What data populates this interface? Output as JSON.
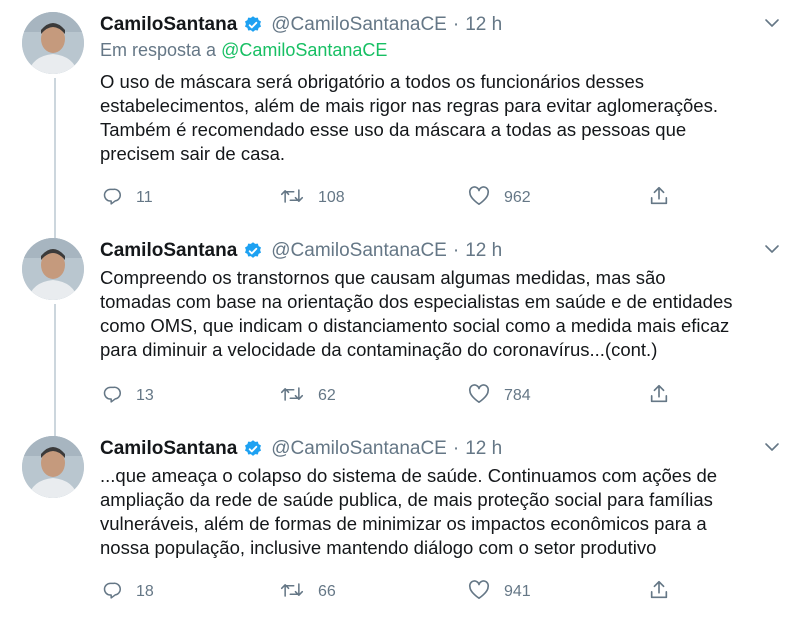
{
  "tweets": [
    {
      "name": "CamiloSantana",
      "handle": "@CamiloSantanaCE",
      "separator": "·",
      "time": "12 h",
      "reply_prefix": "Em resposta a ",
      "reply_mention": "@CamiloSantanaCE",
      "lines": [
        "O uso de máscara será obrigatório a todos os funcionários desses",
        "estabelecimentos, além de mais rigor nas regras para evitar aglomerações.",
        "Também é recomendado esse uso da máscara a todas as pessoas que",
        "precisem sair de casa."
      ],
      "replies": "11",
      "retweets": "108",
      "likes": "962"
    },
    {
      "name": "CamiloSantana",
      "handle": "@CamiloSantanaCE",
      "separator": "·",
      "time": "12 h",
      "lines": [
        "Compreendo os transtornos  que causam algumas medidas, mas são",
        "tomadas com base na orientação dos especialistas em saúde e de entidades",
        "como OMS, que indicam o distanciamento social como a medida mais eficaz",
        "para diminuir a velocidade da contaminação do coronavírus...(cont.)"
      ],
      "replies": "13",
      "retweets": "62",
      "likes": "784"
    },
    {
      "name": "CamiloSantana",
      "handle": "@CamiloSantanaCE",
      "separator": "·",
      "time": "12 h",
      "lines": [
        "...que ameaça o colapso do sistema de saúde. Continuamos com ações de",
        "ampliação da rede de saúde publica, de mais proteção social para famílias",
        "vulneráveis, além de formas de minimizar os impactos econômicos para a",
        "nossa população, inclusive mantendo diálogo com o setor produtivo"
      ],
      "replies": "18",
      "retweets": "66",
      "likes": "941"
    }
  ],
  "icons": {
    "verified": "verified-badge-icon",
    "caret": "chevron-down-icon",
    "reply": "reply-icon",
    "retweet": "retweet-icon",
    "like": "heart-icon",
    "share": "share-icon"
  },
  "colors": {
    "verified": "#1da1f2",
    "mention": "#17bf63",
    "muted": "#657786",
    "thread_line": "#ccd6dd"
  }
}
